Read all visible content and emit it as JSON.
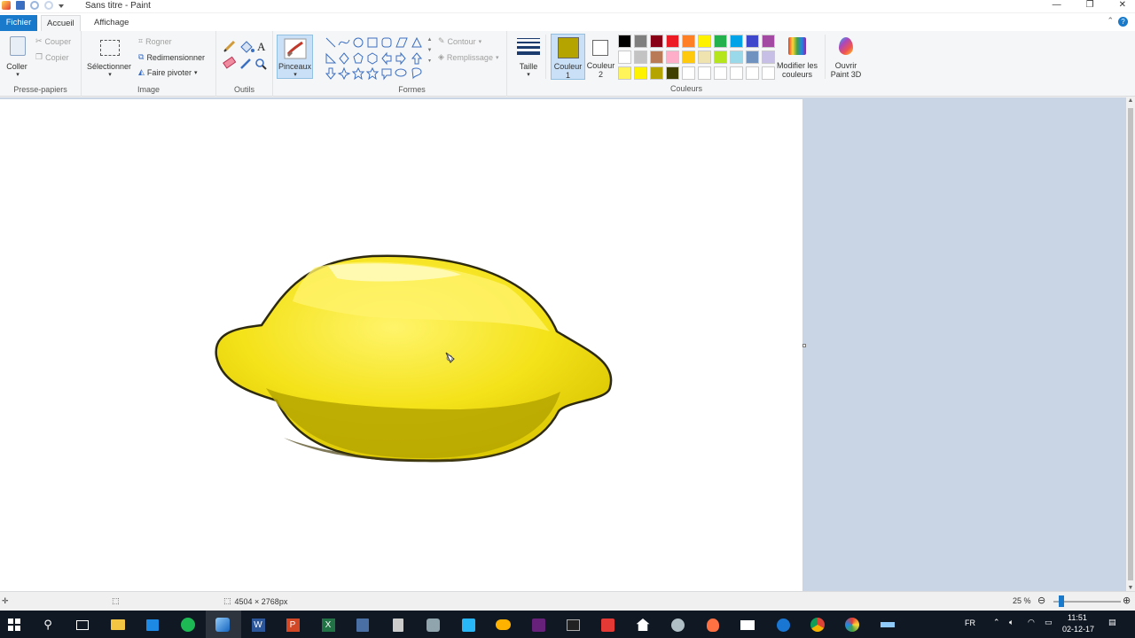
{
  "window": {
    "title": "Sans titre - Paint"
  },
  "tabs": [
    {
      "label": "Fichier"
    },
    {
      "label": "Accueil"
    },
    {
      "label": "Affichage"
    }
  ],
  "clipboard": {
    "paste": "Coller",
    "cut": "Couper",
    "copy": "Copier",
    "group": "Presse-papiers"
  },
  "image": {
    "select": "Sélectionner",
    "crop": "Rogner",
    "resize": "Redimensionner",
    "rotate": "Faire pivoter",
    "group": "Image"
  },
  "tools": {
    "group": "Outils"
  },
  "brushes": {
    "label": "Pinceaux"
  },
  "shapes": {
    "outline": "Contour",
    "fill": "Remplissage",
    "group": "Formes"
  },
  "size": {
    "label": "Taille"
  },
  "colors": {
    "color1": "Couleur",
    "color1_num": "1",
    "color2": "Couleur",
    "color2_num": "2",
    "edit_colors": "Modifier les couleurs",
    "group": "Couleurs",
    "color1_value": "#b5a400",
    "color2_value": "#ffffff",
    "palette": [
      "#000000",
      "#7f7f7f",
      "#880015",
      "#ed1c24",
      "#ff7f27",
      "#fff200",
      "#22b14c",
      "#00a2e8",
      "#3f48cc",
      "#a349a4",
      "#ffffff",
      "#c3c3c3",
      "#b97a57",
      "#ffaec9",
      "#ffc90e",
      "#efe4b0",
      "#b5e61d",
      "#99d9ea",
      "#7092be",
      "#c8bfe7",
      "#fff45a",
      "#fff200",
      "#b5a400",
      "#404000",
      "#ffffff",
      "#ffffff",
      "#ffffff",
      "#ffffff",
      "#ffffff",
      "#ffffff"
    ]
  },
  "paint3d": {
    "label": "Ouvrir Paint 3D"
  },
  "status": {
    "dimensions": "4504 × 2768px",
    "zoom": "25 %"
  },
  "taskbar": {
    "lang": "FR",
    "time": "11:51",
    "date": "02-12-17"
  }
}
